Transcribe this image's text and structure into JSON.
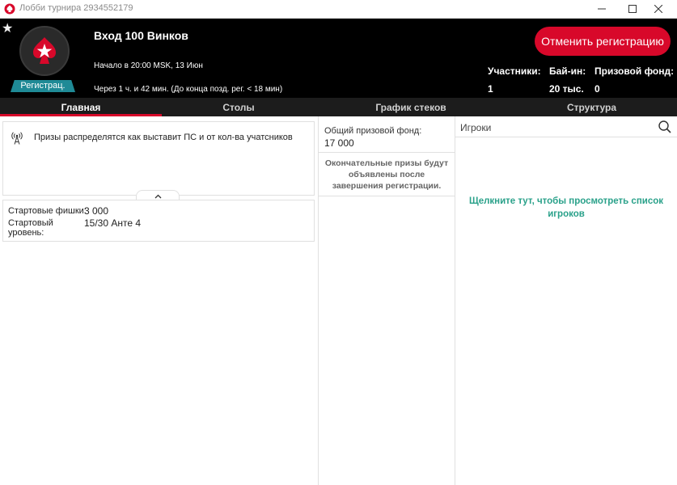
{
  "window": {
    "title": "Лобби турнира 2934552179",
    "controls": [
      "minimize-icon",
      "maximize-icon",
      "close-icon"
    ]
  },
  "header": {
    "favorite_icon": "star-icon",
    "logo_icon": "pokerstars-spade-logo",
    "status_badge": "Регистрац.",
    "tournament_name": "Вход 100 Винков",
    "start_text": "Начало в 20:00 MSK, 13 Июн",
    "late_reg_text": "Через 1 ч. и 42 мин. (До конца позд. рег. < 18 мин)",
    "cancel_button": "Отменить регистрацию",
    "stats": [
      {
        "label": "Участники:",
        "value": "1"
      },
      {
        "label": "Бай-ин:",
        "value": "20 тыс."
      },
      {
        "label": "Призовой фонд:",
        "value": "0"
      }
    ]
  },
  "tabs": [
    {
      "label": "Главная",
      "active": true
    },
    {
      "label": "Столы",
      "active": false
    },
    {
      "label": "График стеков",
      "active": false
    },
    {
      "label": "Структура",
      "active": false
    }
  ],
  "main": {
    "info_icon": "antenna-icon",
    "info_text": "Призы распределятся как выставит ПС и от кол-ва учатсников",
    "collapse_icon": "chevron-up-icon",
    "details": [
      {
        "key": "Стартовые фишки:",
        "value": "3 000"
      },
      {
        "key": "Стартовый уровень:",
        "value": "15/30 Анте 4"
      }
    ]
  },
  "prize": {
    "label": "Общий призовой фонд:",
    "value": "17 000",
    "note": "Окончательные призы будут объявлены после завершения регистрации."
  },
  "players": {
    "title": "Игроки",
    "search_icon": "search-icon",
    "link_text": "Щелкните тут, чтобы просмотреть список игроков"
  },
  "colors": {
    "accent_red": "#d8082a",
    "badge_teal": "#1f8a96",
    "link_green": "#2aa18a",
    "header_bg": "#000000",
    "tab_bg": "#1c1c1c"
  }
}
